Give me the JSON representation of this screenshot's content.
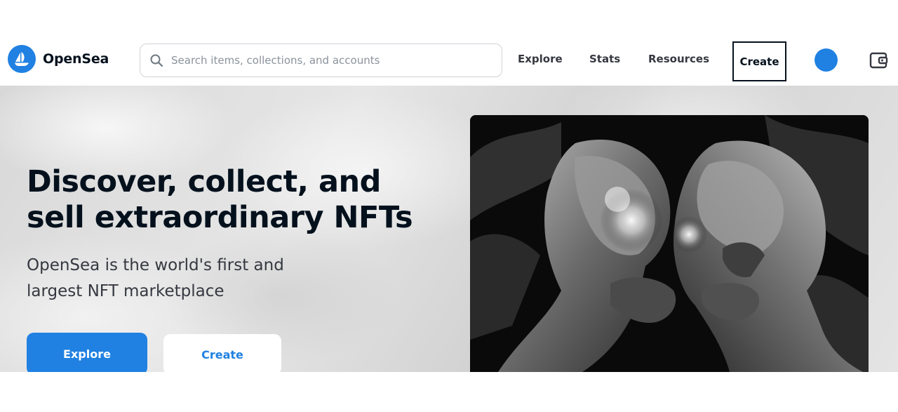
{
  "brand": {
    "name": "OpenSea",
    "accent": "#2081e2",
    "logo_icon": "opensea-sailboat-icon"
  },
  "search": {
    "placeholder": "Search items, collections, and accounts",
    "value": "",
    "icon": "search-icon"
  },
  "nav": {
    "links": [
      {
        "label": "Explore"
      },
      {
        "label": "Stats"
      },
      {
        "label": "Resources"
      }
    ],
    "create_label": "Create",
    "avatar_icon": "user-avatar-icon",
    "wallet_icon": "wallet-icon"
  },
  "hero": {
    "title": "Discover, collect, and sell extraordinary NFTs",
    "subtitle": "OpenSea is the world's first and largest NFT marketplace",
    "explore_label": "Explore",
    "create_label": "Create",
    "artwork_icon": "featured-nft-artwork"
  }
}
